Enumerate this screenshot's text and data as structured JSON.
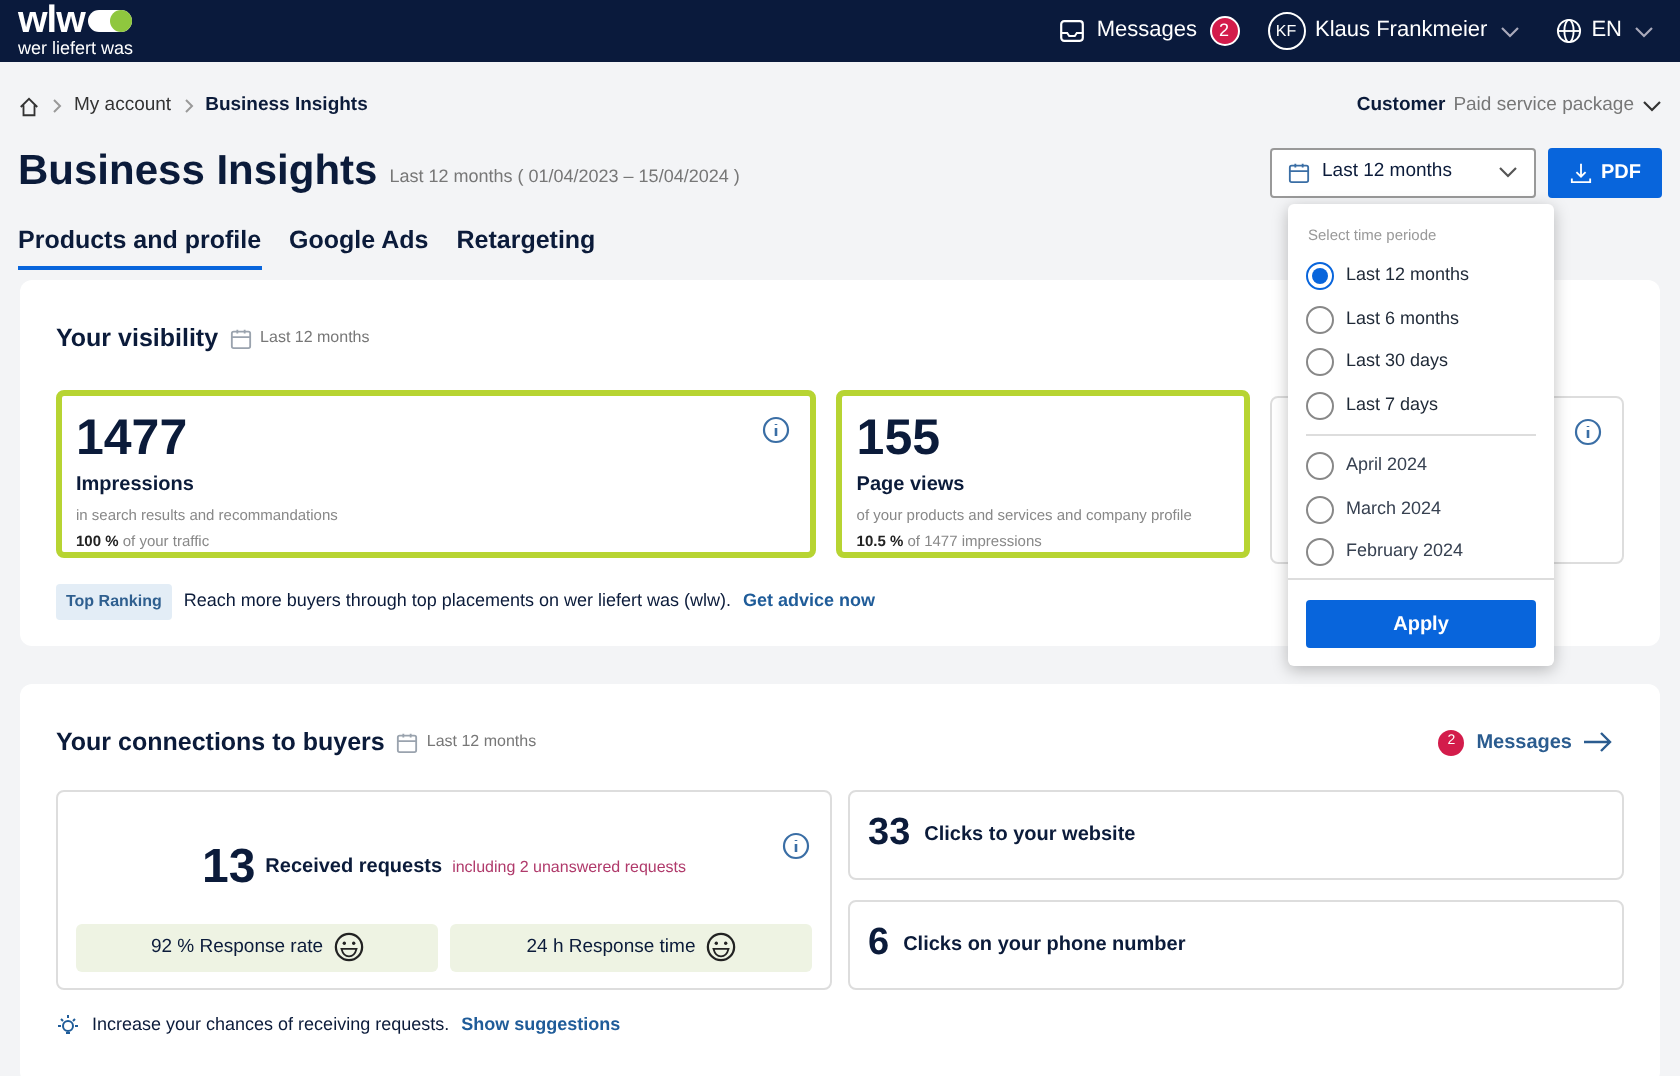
{
  "header": {
    "logo_text": "wlw",
    "logo_subtitle": "wer liefert was",
    "messages": {
      "label": "Messages",
      "count": "2"
    },
    "user": {
      "initials": "KF",
      "name": "Klaus Frankmeier"
    },
    "language": "EN"
  },
  "breadcrumb": [
    "My account",
    "Business Insights"
  ],
  "package": {
    "label": "Customer",
    "value": "Paid service package"
  },
  "page": {
    "title": "Business Insights",
    "period": "Last 12 months ( 01/04/2023 – 15/04/2024 )"
  },
  "period_select": {
    "value": "Last 12 months",
    "expanded": true
  },
  "pdf_button": "PDF",
  "tabs": [
    {
      "label": "Products and profile",
      "selected": true
    },
    {
      "label": "Google Ads",
      "selected": false
    },
    {
      "label": "Retargeting",
      "selected": false
    }
  ],
  "visibility": {
    "title": "Your visibility",
    "period": "Last 12 months",
    "cards": [
      {
        "value": "1477",
        "label": "Impressions",
        "description": "in search results and recommandations",
        "share": "100 %",
        "share_text": "of your traffic",
        "highlighted": true
      },
      {
        "value": "155",
        "label": "Page views",
        "description": "of your products and services and company profile",
        "share": "10.5 %",
        "share_text": "of 1477 impressions",
        "highlighted": true
      },
      {
        "highlighted": false
      }
    ],
    "ranking": {
      "badge": "Top Ranking",
      "text": "Reach more buyers through top placements on  wer liefert was (wlw).",
      "link": "Get advice now"
    }
  },
  "dropdown": {
    "heading": "Select time periode",
    "options": [
      {
        "label": "Last 12 months",
        "selected": true,
        "kind": "range"
      },
      {
        "label": "Last 6 months",
        "selected": false,
        "kind": "range"
      },
      {
        "label": "Last 30 days",
        "selected": false,
        "kind": "range"
      },
      {
        "label": "Last 7 days",
        "selected": false,
        "kind": "range"
      },
      {
        "label": "April 2024",
        "selected": false,
        "kind": "month"
      },
      {
        "label": "March 2024",
        "selected": false,
        "kind": "month"
      },
      {
        "label": "February 2024",
        "selected": false,
        "kind": "month"
      }
    ],
    "apply": "Apply"
  },
  "connections": {
    "title": "Your connections to buyers",
    "period": "Last 12 months",
    "messages_link": {
      "count": "2",
      "label": "Messages"
    },
    "requests": {
      "value": "13",
      "label": "Received requests",
      "note": "including 2 unanswered requests",
      "stats": [
        "92 % Response rate",
        "24 h Response time"
      ]
    },
    "clicks": [
      {
        "value": "33",
        "label": "Clicks to your website"
      },
      {
        "value": "6",
        "label": "Clicks on your phone number"
      }
    ],
    "tip": {
      "text": "Increase your chances of receiving requests.",
      "link": "Show suggestions"
    }
  }
}
